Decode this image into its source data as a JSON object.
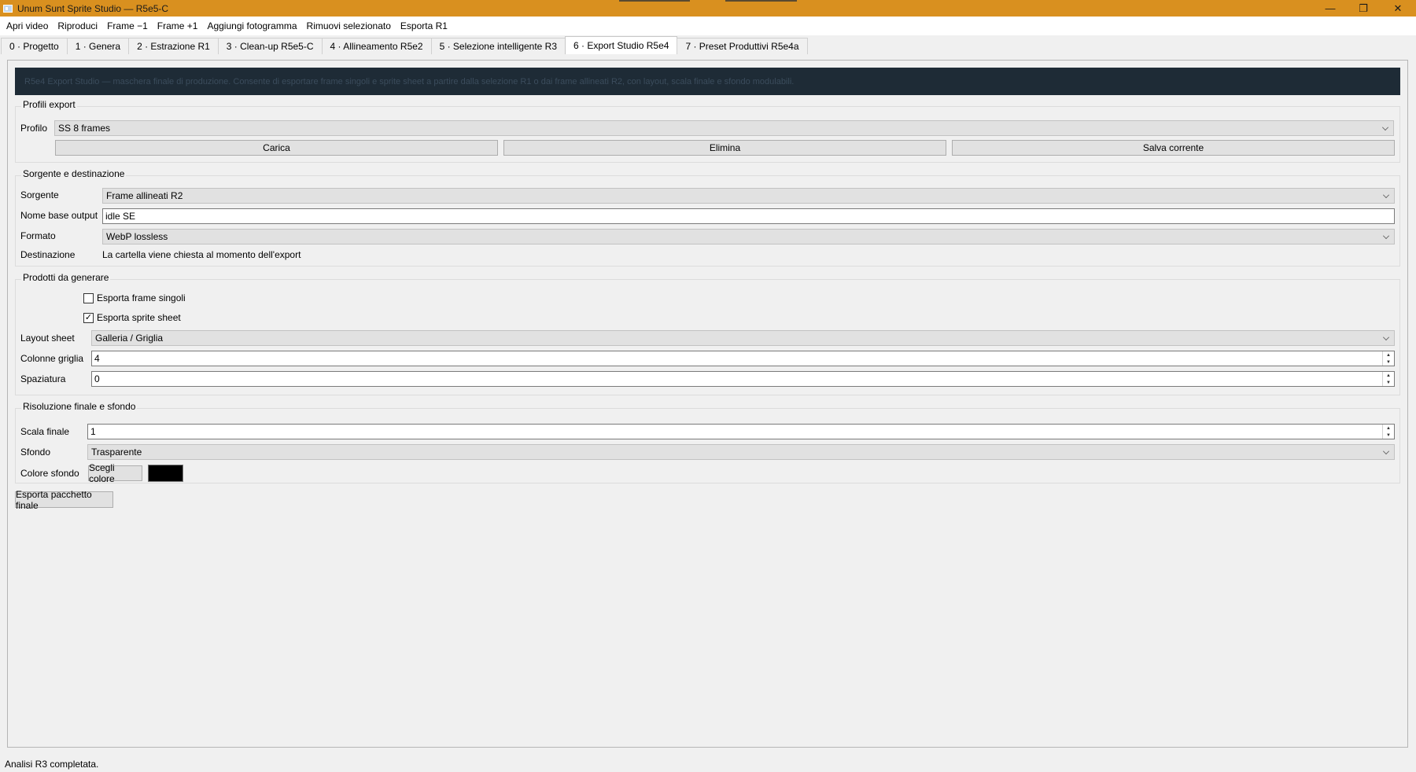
{
  "window": {
    "title": "Unum Sunt Sprite Studio — R5e5-C",
    "minimize_icon": "—",
    "restore_icon": "❐",
    "close_icon": "✕"
  },
  "menu": [
    "Apri video",
    "Riproduci",
    "Frame −1",
    "Frame +1",
    "Aggiungi fotogramma",
    "Rimuovi selezionato",
    "Esporta R1"
  ],
  "tabs": [
    {
      "label": "0 · Progetto",
      "active": false
    },
    {
      "label": "1 · Genera",
      "active": false
    },
    {
      "label": "2 · Estrazione R1",
      "active": false
    },
    {
      "label": "3 · Clean-up R5e5-C",
      "active": false
    },
    {
      "label": "4 · Allineamento R5e2",
      "active": false
    },
    {
      "label": "5 · Selezione intelligente R3",
      "active": false
    },
    {
      "label": "6 · Export Studio R5e4",
      "active": true
    },
    {
      "label": "7 · Preset Produttivi R5e4a",
      "active": false
    }
  ],
  "banner": "R5e4 Export Studio — maschera finale di produzione. Consente di esportare frame singoli e sprite sheet a partire dalla selezione R1 o dai frame allineati R2, con layout, scala finale e sfondo modulabili.",
  "profiles": {
    "title": "Profili export",
    "profile_label": "Profilo",
    "profile_value": "SS 8 frames",
    "load_label": "Carica",
    "delete_label": "Elimina",
    "save_label": "Salva corrente"
  },
  "source": {
    "title": "Sorgente e destinazione",
    "source_label": "Sorgente",
    "source_value": "Frame allineati R2",
    "basename_label": "Nome base output",
    "basename_value": "idle SE",
    "format_label": "Formato",
    "format_value": "WebP lossless",
    "dest_label": "Destinazione",
    "dest_value": "La cartella viene chiesta al momento dell'export"
  },
  "products": {
    "title": "Prodotti da generare",
    "single_frames_label": "Esporta frame singoli",
    "single_frames_checked": false,
    "sprite_sheet_label": "Esporta sprite sheet",
    "sprite_sheet_checked": true,
    "layout_label": "Layout sheet",
    "layout_value": "Galleria / Griglia",
    "columns_label": "Colonne griglia",
    "columns_value": "4",
    "spacing_label": "Spaziatura",
    "spacing_value": "0"
  },
  "resolution": {
    "title": "Risoluzione finale e sfondo",
    "scale_label": "Scala finale",
    "scale_value": "1",
    "background_label": "Sfondo",
    "background_value": "Trasparente",
    "bgcolor_label": "Colore sfondo",
    "choose_color_label": "Scegli colore",
    "bg_color": "#000000"
  },
  "export_button": "Esporta pacchetto finale",
  "status": "Analisi R3 completata.",
  "colors": {
    "titlebar": "#d9901f",
    "banner_bg": "#1e2b36"
  }
}
